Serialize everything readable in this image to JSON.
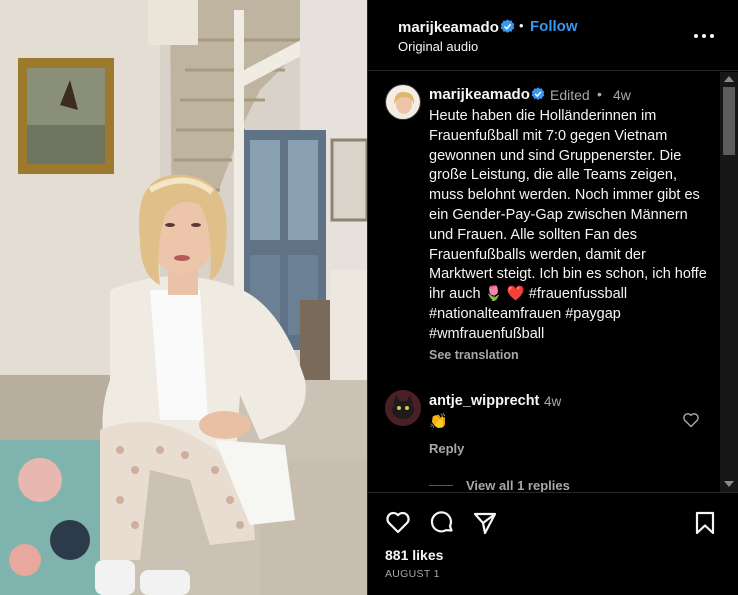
{
  "colors": {
    "accent": "#3897f0",
    "verified": "#3897f0",
    "background": "#000000",
    "muted": "#a8a8a8"
  },
  "header": {
    "author": "marijkeamado",
    "dot": "•",
    "follow_label": "Follow",
    "audio": "Original audio",
    "more_icon": "more-horizontal-icon"
  },
  "caption": {
    "username": "marijkeamado",
    "edited": "Edited",
    "dot": "•",
    "time": "4w",
    "text": "Heute haben die Holländerinnen im Frauenfußball mit 7:0 gegen Vietnam gewonnen und sind Gruppenerster. Die große Leistung, die alle Teams zeigen, muss belohnt werden. Noch immer gibt es ein Gender-Pay-Gap zwischen Männern und Frauen. Alle sollten Fan des Frauenfußballs werden, damit der Marktwert steigt. Ich bin es schon, ich hoffe ihr auch 🌷 ❤️ #frauenfussball #nationalteamfrauen #paygap #wmfrauenfußball",
    "see_translation": "See translation"
  },
  "comments": [
    {
      "username": "antje_wipprecht",
      "time": "4w",
      "text": "👏",
      "reply_label": "Reply",
      "like_icon": "heart-outline-icon"
    }
  ],
  "view_replies": "View all 1 replies",
  "actions": {
    "icons": [
      "heart-icon",
      "comment-icon",
      "share-icon",
      "bookmark-icon"
    ],
    "likes": "881 likes",
    "date": "AUGUST 1"
  }
}
